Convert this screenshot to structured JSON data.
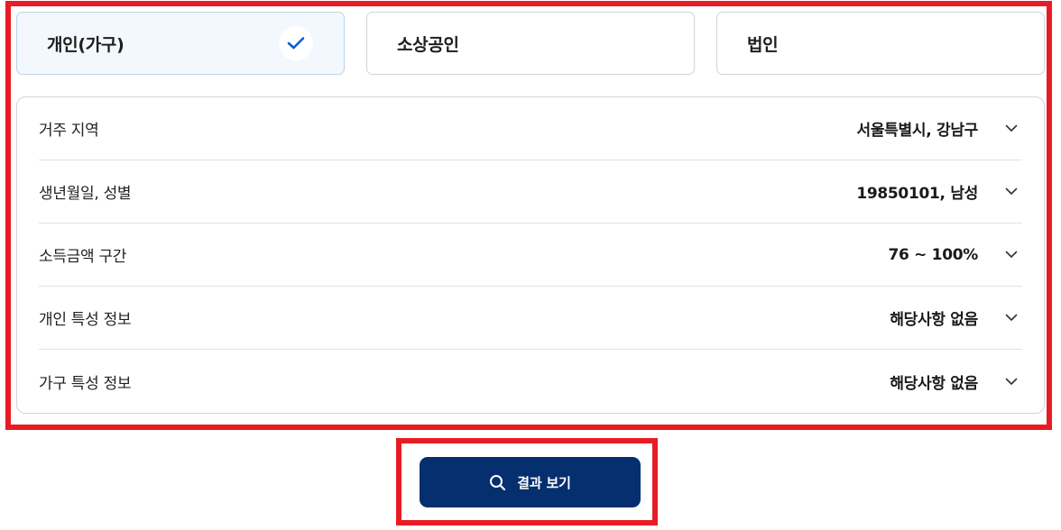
{
  "tabs": [
    {
      "label": "개인(가구)",
      "selected": true
    },
    {
      "label": "소상공인",
      "selected": false
    },
    {
      "label": "법인",
      "selected": false
    }
  ],
  "rows": [
    {
      "label": "거주 지역",
      "value": "서울특별시, 강남구"
    },
    {
      "label": "생년월일, 성별",
      "value": "19850101, 남성"
    },
    {
      "label": "소득금액 구간",
      "value": "76 ~ 100%"
    },
    {
      "label": "개인 특성 정보",
      "value": "해당사항 없음"
    },
    {
      "label": "가구 특성 정보",
      "value": "해당사항 없음"
    }
  ],
  "result_button": {
    "label": "결과 보기"
  },
  "colors": {
    "highlight": "#e81c24",
    "accent": "#0b5ed7",
    "button": "#052f6e"
  },
  "icons": {
    "check": "check-icon",
    "chevron": "chevron-down-icon",
    "search": "search-icon"
  }
}
